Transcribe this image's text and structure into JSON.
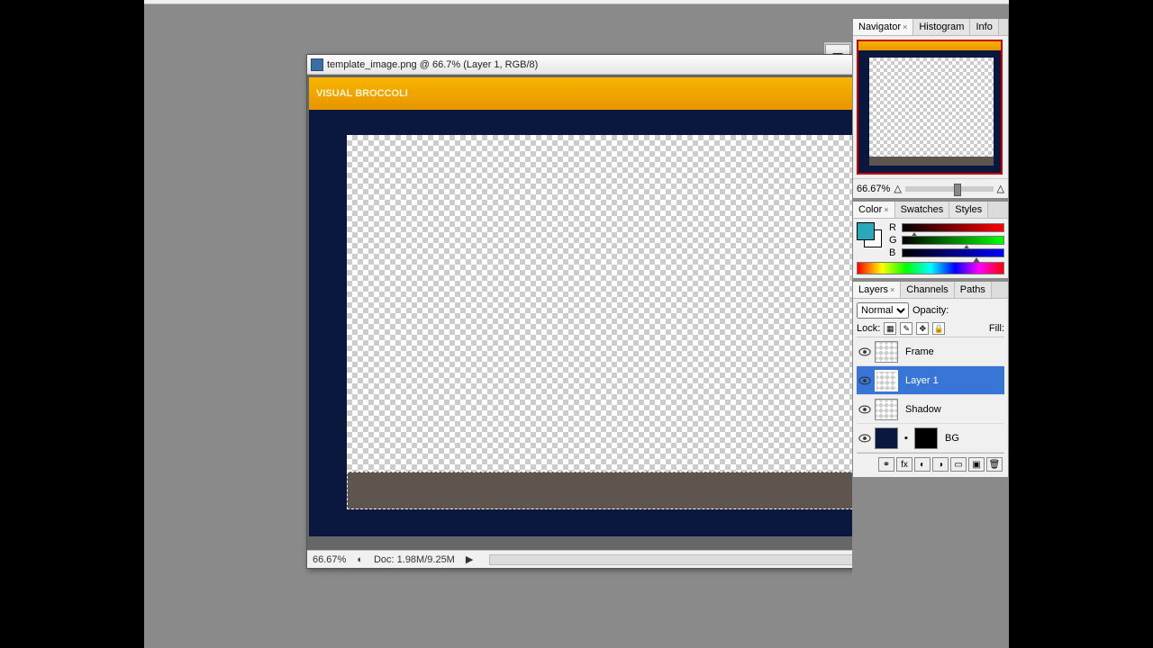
{
  "doc": {
    "title": "template_image.png @ 66.7% (Layer 1, RGB/8)",
    "zoom": "66.67%",
    "docsize": "Doc: 1.98M/9.25M",
    "brand": "VISUAL BROCCOLI"
  },
  "navigator": {
    "tabs": [
      "Navigator",
      "Histogram",
      "Info"
    ],
    "active": 0,
    "zoom": "66.67%"
  },
  "color": {
    "tabs": [
      "Color",
      "Swatches",
      "Styles"
    ],
    "active": 0,
    "labels": {
      "r": "R",
      "g": "G",
      "b": "B"
    }
  },
  "layers": {
    "tabs": [
      "Layers",
      "Channels",
      "Paths"
    ],
    "active": 0,
    "blend": "Normal",
    "opacity_label": "Opacity:",
    "fill_label": "Fill:",
    "lock_label": "Lock:",
    "items": [
      {
        "name": "Frame",
        "selected": false,
        "solid": false
      },
      {
        "name": "Layer 1",
        "selected": true,
        "solid": false
      },
      {
        "name": "Shadow",
        "selected": false,
        "solid": false
      },
      {
        "name": "BG",
        "selected": false,
        "solid": true
      }
    ]
  }
}
